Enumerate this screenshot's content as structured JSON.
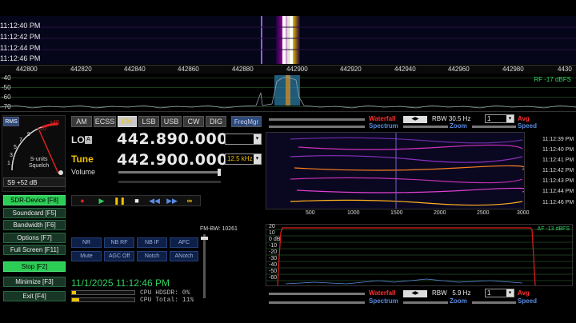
{
  "waterfall": {
    "times": [
      "11:12:40 PM",
      "11:12:42 PM",
      "11:12:44 PM",
      "11:12:46 PM"
    ],
    "freq_ticks": [
      "442800",
      "442820",
      "442840",
      "442860",
      "442880",
      "442900",
      "442920",
      "442940",
      "442960",
      "442980",
      "4430"
    ],
    "db_ticks": [
      "-40",
      "-50",
      "-60",
      "-70"
    ],
    "rf_level": "RF -17 dBFS"
  },
  "smeter": {
    "mode_button": "RMS",
    "scale_labels": [
      "+40",
      "+20",
      "9",
      "7",
      "5",
      "3",
      "1"
    ],
    "units_label": "S-units",
    "squelch_label": "Squelch",
    "reading": "S9 +52 dB"
  },
  "side_buttons": [
    {
      "label": "SDR-Device [F8]",
      "active": true
    },
    {
      "label": "Soundcard [F5]",
      "active": false
    },
    {
      "label": "Bandwidth [F6]",
      "active": false
    },
    {
      "label": "Options [F7]",
      "active": false
    },
    {
      "label": "Full Screen [F11]",
      "active": false
    },
    {
      "label": "Stop [F2]",
      "active": true
    },
    {
      "label": "Minimize [F3]",
      "active": false
    },
    {
      "label": "Exit [F4]",
      "active": false
    }
  ],
  "modes": [
    "AM",
    "ECSS",
    "FM",
    "LSB",
    "USB",
    "CW",
    "DIG"
  ],
  "active_mode": "FM",
  "freqmgr_label": "FreqMgr",
  "lo": {
    "label": "LO",
    "tag": "A",
    "frequency": "442.890.000"
  },
  "tune": {
    "label": "Tune",
    "frequency": "442.900.000",
    "step": "12.5 kHz"
  },
  "volume_label": "Volume",
  "fm_bw": "FM-BW: 10261",
  "dsp_buttons": [
    [
      "NR",
      "NB RF",
      "NB IF",
      "AFC"
    ],
    [
      "Mute",
      "AGC Off",
      "Notch",
      "ANotch"
    ]
  ],
  "status": {
    "datetime": "11/1/2025 11:12:46 PM",
    "cpu_hdsdr": "CPU HDSDR:  0%",
    "cpu_total": "CPU Total: 11%",
    "cpu_hdsdr_level": 0,
    "cpu_total_level": 0.11
  },
  "top_controls": {
    "waterfall": "Waterfall",
    "spectrum": "Spectrum",
    "rbw": "RBW 30.5 Hz",
    "value": "1",
    "avg": "Avg",
    "zoom": "Zoom",
    "speed": "Speed"
  },
  "audio_waterfall": {
    "times": [
      "11:12:39 PM",
      "11:12:40 PM",
      "11:12:41 PM",
      "11:12:42 PM",
      "11:12:43 PM",
      "11:12:44 PM",
      "11:12:46 PM"
    ],
    "freq_ticks": [
      "500",
      "1000",
      "1500",
      "2000",
      "2500",
      "3000"
    ]
  },
  "af_spectrum": {
    "db_ticks": [
      "20",
      "10",
      "0 dB",
      "-10",
      "-20",
      "-30",
      "-40",
      "-50",
      "-60"
    ],
    "af_level": "AF -13 dBFS"
  },
  "bottom_controls": {
    "waterfall": "Waterfall",
    "spectrum": "Spectrum",
    "rbw": "RBW   5.9 Hz",
    "value": "1",
    "avg": "Avg",
    "zoom": "Zoom",
    "speed": "Speed"
  },
  "colors": {
    "accent_green": "#30d060",
    "button_green": "#2ccd55",
    "mode_yellow": "#f2c400",
    "label_red": "#ff3030",
    "label_blue": "#5a8ae0"
  }
}
